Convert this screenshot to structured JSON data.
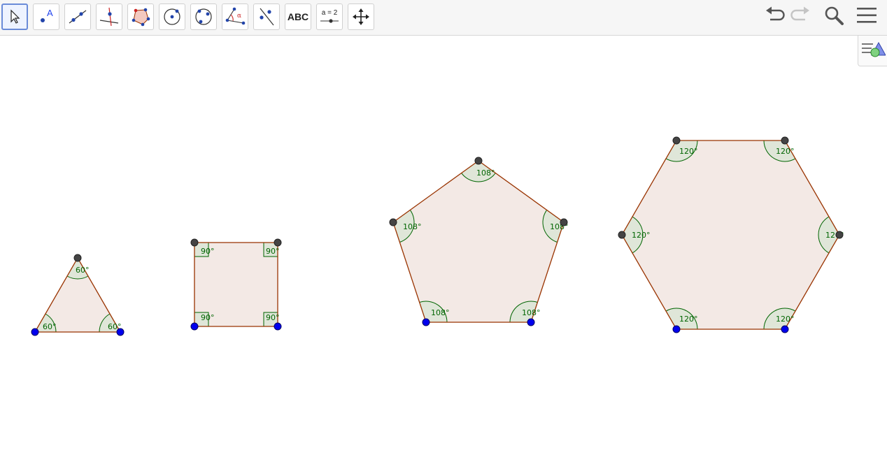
{
  "toolbar": {
    "tools": [
      {
        "id": "move",
        "name": "move-tool",
        "icon": "arrow-cursor-icon"
      },
      {
        "id": "point",
        "name": "point-tool",
        "icon": "point-icon",
        "letter": "A"
      },
      {
        "id": "line",
        "name": "line-tool",
        "icon": "line-icon"
      },
      {
        "id": "perpendicular",
        "name": "perpendicular-line-tool",
        "icon": "perpendicular-icon"
      },
      {
        "id": "polygon",
        "name": "polygon-tool",
        "icon": "polygon-icon"
      },
      {
        "id": "circle",
        "name": "circle-tool",
        "icon": "circle-center-point-icon"
      },
      {
        "id": "circle3",
        "name": "circle-three-points-tool",
        "icon": "circle-three-points-icon"
      },
      {
        "id": "angle",
        "name": "angle-tool",
        "icon": "angle-icon",
        "letter": "α"
      },
      {
        "id": "reflect",
        "name": "reflect-tool",
        "icon": "reflect-line-icon"
      },
      {
        "id": "text",
        "name": "text-tool",
        "icon": "text-icon",
        "label": "ABC"
      },
      {
        "id": "slider",
        "name": "slider-tool",
        "icon": "slider-icon",
        "label": "a = 2"
      },
      {
        "id": "movegraphics",
        "name": "move-graphics-tool",
        "icon": "move-graphics-icon"
      }
    ],
    "right": [
      {
        "name": "undo-button",
        "icon": "undo-icon",
        "enabled": true
      },
      {
        "name": "redo-button",
        "icon": "redo-icon",
        "enabled": false
      },
      {
        "name": "search-button",
        "icon": "search-icon",
        "enabled": true
      },
      {
        "name": "menu-button",
        "icon": "menu-icon",
        "enabled": true
      }
    ]
  },
  "style_bar_toggle": {
    "icon": "style-bar-icon"
  },
  "colors": {
    "fill": "#f3e9e5",
    "edge": "#993300",
    "angle_stroke": "#006400",
    "angle_fill": "#dfe6d8",
    "free_point": "#0000ee",
    "dependent_point": "#444444"
  },
  "labels": {
    "triangle": [
      "60°",
      "60°",
      "60°"
    ],
    "square": [
      "90°",
      "90°",
      "90°",
      "90°"
    ],
    "pentagon": [
      "108°",
      "108°",
      "108°",
      "108°",
      "108°"
    ],
    "hexagon": [
      "120°",
      "120°",
      "120°",
      "120°",
      "120°",
      "120°"
    ]
  }
}
